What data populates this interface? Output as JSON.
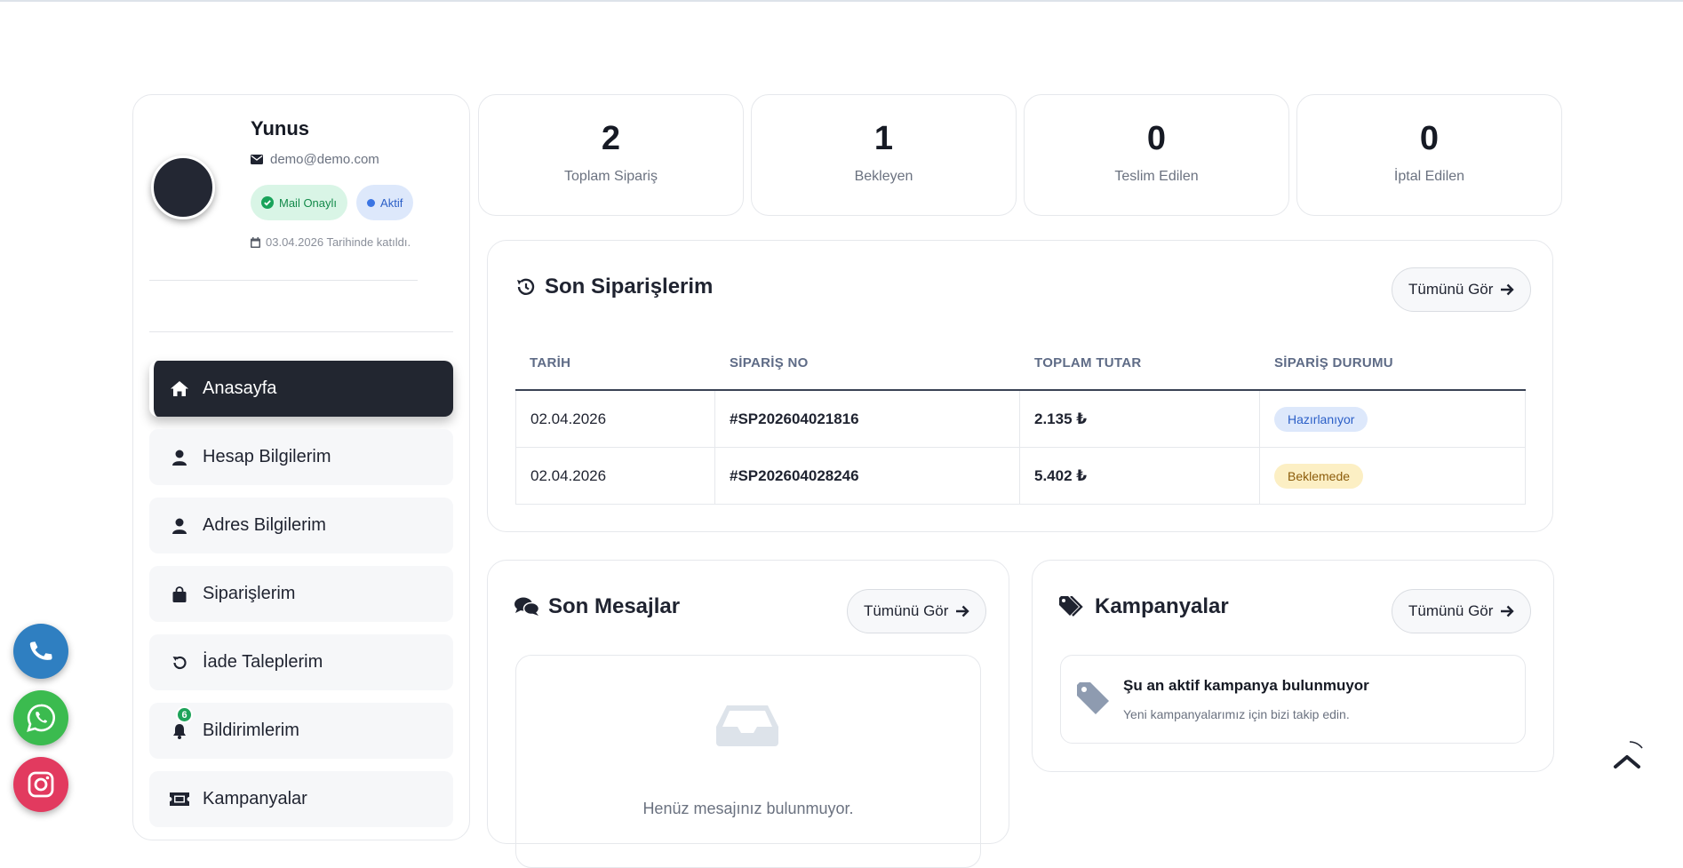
{
  "profile": {
    "name": "Yunus",
    "email": "demo@demo.com",
    "badge_mail": "Mail Onaylı",
    "badge_status": "Aktif",
    "joined": "03.04.2026 Tarihinde katıldı."
  },
  "menu": {
    "items": [
      {
        "label": "Anasayfa",
        "icon": "home-icon",
        "active": true
      },
      {
        "label": "Hesap Bilgilerim",
        "icon": "user-icon"
      },
      {
        "label": "Adres Bilgilerim",
        "icon": "user-icon"
      },
      {
        "label": "Siparişlerim",
        "icon": "bag-icon"
      },
      {
        "label": "İade Taleplerim",
        "icon": "undo-icon"
      },
      {
        "label": "Bildirimlerim",
        "icon": "bell-icon",
        "count": "6"
      },
      {
        "label": "Kampanyalar",
        "icon": "ticket-icon"
      }
    ]
  },
  "stats": [
    {
      "value": "2",
      "label": "Toplam Sipariş"
    },
    {
      "value": "1",
      "label": "Bekleyen"
    },
    {
      "value": "0",
      "label": "Teslim Edilen"
    },
    {
      "value": "0",
      "label": "İptal Edilen"
    }
  ],
  "orders": {
    "title": "Son Siparişlerim",
    "see_all": "Tümünü Gör",
    "columns": [
      "TARİH",
      "SİPARİŞ NO",
      "TOPLAM TUTAR",
      "SİPARİŞ DURUMU"
    ],
    "rows": [
      {
        "date": "02.04.2026",
        "no": "#SP202604021816",
        "total": "2.135 ₺",
        "status": "Hazırlanıyor",
        "status_color": "#2b5fc7"
      },
      {
        "date": "02.04.2026",
        "no": "#SP202604028246",
        "total": "5.402 ₺",
        "status": "Beklemede",
        "status_color": "#8c5c0b"
      }
    ]
  },
  "messages": {
    "title": "Son Mesajlar",
    "see_all": "Tümünü Gör",
    "empty": "Henüz mesajınız bulunmuyor."
  },
  "campaigns": {
    "title": "Kampanyalar",
    "see_all": "Tümünü Gör",
    "empty_title": "Şu an aktif kampanya bulunmuyor",
    "empty_sub": "Yeni kampanyalarımız için bizi takip edin."
  },
  "colors": {
    "accent_dark": "#222630",
    "phone": "#2f7fc1",
    "whatsapp": "#3bbb4f",
    "instagram": "#e23a5f"
  }
}
